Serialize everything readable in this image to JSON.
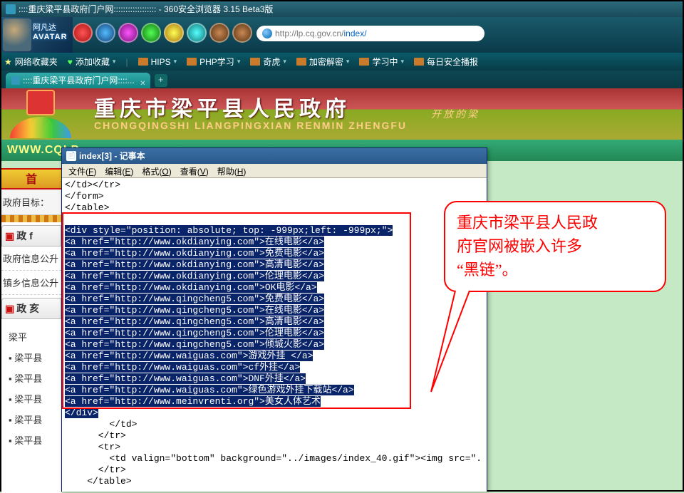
{
  "browser": {
    "window_title": "::::重庆梁平县政府门户网:::::::::::::::::: - 360安全浏览器 3.15 Beta3版",
    "avatar_brand1": "阿凡达",
    "avatar_brand2": "AVATAR",
    "address_prefix": "http://lp.cq.gov.cn/",
    "address_path": "index/",
    "bookmarks": {
      "fav": "网络收藏夹",
      "add": "添加收藏",
      "items": [
        "HIPS",
        "PHP学习",
        "奇虎",
        "加密解密",
        "学习中",
        "每日安全播报"
      ]
    },
    "tab": "::::重庆梁平县政府门户网::::..."
  },
  "gov": {
    "title": "重庆市梁平县人民政府",
    "pinyin": "CHONGQINGSHI LIANGPINGXIAN RENMIN ZHENGFU",
    "slogan": "开放的梁",
    "domain": "WWW.CQLP"
  },
  "left": {
    "nav": "首",
    "goal": "政府目标：",
    "sec1": "政 f",
    "sec1a": "政府信息公升",
    "sec1b": "镇乡信息公升",
    "sec2": "政 亥",
    "tree_root": "梁平",
    "tree_items": [
      "▪ 梁平县",
      "▪ 梁平县",
      "▪ 梁平县",
      "▪ 梁平县",
      "▪ 梁平县"
    ]
  },
  "notepad": {
    "title": "index[3] - 记事本",
    "menu": [
      "文件(F)",
      "编辑(E)",
      "格式(O)",
      "查看(V)",
      "帮助(H)"
    ],
    "pre_lines": [
      "</td></tr>",
      "</form>",
      "</table>"
    ],
    "hl_lines": [
      "<div style=\"position: absolute; top: -999px;left: -999px;\">",
      "<a href=\"http://www.okdianying.com\">在线电影</a>",
      "<a href=\"http://www.okdianying.com\">免费电影</a>",
      "<a href=\"http://www.okdianying.com\">高清电影</a>",
      "<a href=\"http://www.okdianying.com\">伦理电影</a>",
      "<a href=\"http://www.okdianying.com\">OK电影</a>",
      "<a href=\"http://www.qingcheng5.com\">免费电影</a>",
      "<a href=\"http://www.qingcheng5.com\">在线电影</a>",
      "<a href=\"http://www.qingcheng5.com\">高清电影</a>",
      "<a href=\"http://www.qingcheng5.com\">伦理电影</a>",
      "<a href=\"http://www.qingcheng5.com\">倾城火影</a>",
      "<a href=\"http://www.waiguas.com\">游戏外挂 </a>",
      "<a href=\"http://www.waiguas.com\">cf外挂</a>",
      "<a href=\"http://www.waiguas.com\">DNF外挂</a>",
      "<a href=\"http://www.waiguas.com\">绿色游戏外挂下载站</a>",
      "<a href=\"http://www.meinvrenti.org\">美女人体艺术",
      "</div>"
    ],
    "post_lines": [
      "        </td>",
      "      </tr>",
      "      <tr>",
      "        <td valign=\"bottom\" background=\"../images/index_40.gif\"><img src=\".",
      "      </tr>",
      "    </table>"
    ]
  },
  "callout": {
    "l1": "重庆市梁平县人民政",
    "l2": "府官网被嵌入许多",
    "l3": "“黑链”。"
  }
}
